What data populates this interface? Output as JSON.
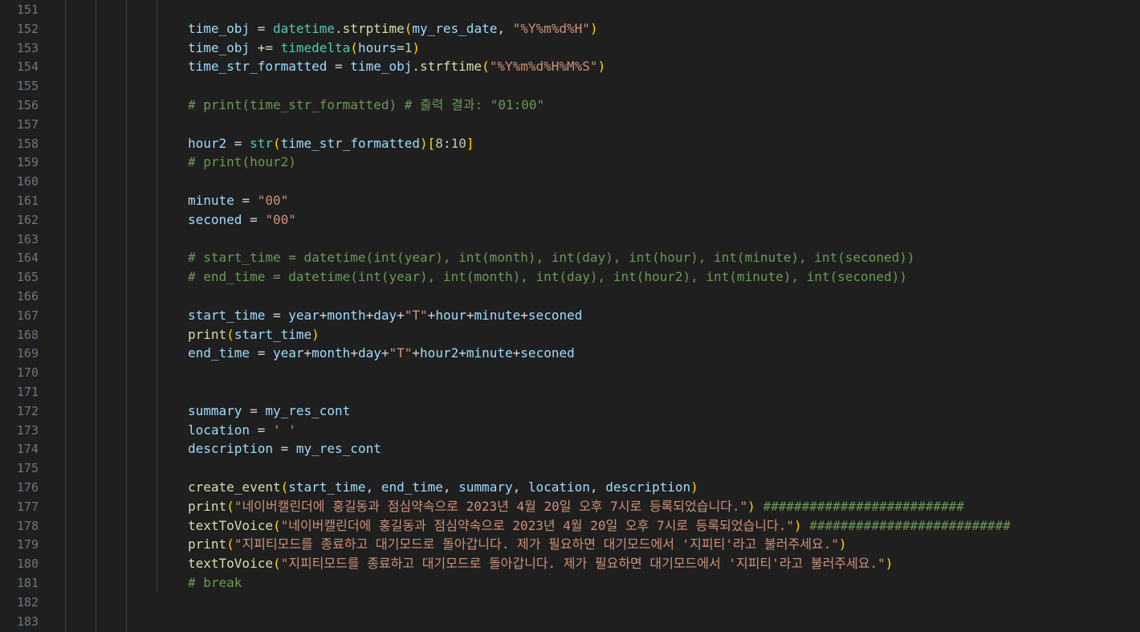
{
  "editor": {
    "lines": [
      {
        "n": "151",
        "tokens": []
      },
      {
        "n": "152",
        "tokens": [
          [
            "time_obj",
            "t-def"
          ],
          [
            " = ",
            "t-op"
          ],
          [
            "datetime",
            "t-cls"
          ],
          [
            ".",
            "t-op"
          ],
          [
            "strptime",
            "t-fn"
          ],
          [
            "(",
            "t-br1"
          ],
          [
            "my_res_date",
            "t-def"
          ],
          [
            ", ",
            "t-op"
          ],
          [
            "\"%Y%m%d%H\"",
            "t-str"
          ],
          [
            ")",
            "t-br1"
          ]
        ]
      },
      {
        "n": "153",
        "tokens": [
          [
            "time_obj",
            "t-def"
          ],
          [
            " += ",
            "t-op"
          ],
          [
            "timedelta",
            "t-cls"
          ],
          [
            "(",
            "t-br1"
          ],
          [
            "hours",
            "t-def"
          ],
          [
            "=",
            "t-op"
          ],
          [
            "1",
            "t-num"
          ],
          [
            ")",
            "t-br1"
          ]
        ]
      },
      {
        "n": "154",
        "tokens": [
          [
            "time_str_formatted",
            "t-def"
          ],
          [
            " = ",
            "t-op"
          ],
          [
            "time_obj",
            "t-def"
          ],
          [
            ".",
            "t-op"
          ],
          [
            "strftime",
            "t-fn"
          ],
          [
            "(",
            "t-br1"
          ],
          [
            "\"%Y%m%d%H%M%S\"",
            "t-str"
          ],
          [
            ")",
            "t-br1"
          ]
        ]
      },
      {
        "n": "155",
        "tokens": []
      },
      {
        "n": "156",
        "tokens": [
          [
            "# print(time_str_formatted) # 출력 결과: \"01:00\"",
            "t-cmt"
          ]
        ]
      },
      {
        "n": "157",
        "tokens": []
      },
      {
        "n": "158",
        "tokens": [
          [
            "hour2",
            "t-def"
          ],
          [
            " = ",
            "t-op"
          ],
          [
            "str",
            "t-cls"
          ],
          [
            "(",
            "t-br1"
          ],
          [
            "time_str_formatted",
            "t-def"
          ],
          [
            ")",
            "t-br1"
          ],
          [
            "[",
            "t-br1"
          ],
          [
            "8",
            "t-num"
          ],
          [
            ":",
            "t-op"
          ],
          [
            "10",
            "t-num"
          ],
          [
            "]",
            "t-br1"
          ]
        ]
      },
      {
        "n": "159",
        "tokens": [
          [
            "# print(hour2)",
            "t-cmt"
          ]
        ]
      },
      {
        "n": "160",
        "tokens": []
      },
      {
        "n": "161",
        "tokens": [
          [
            "minute",
            "t-def"
          ],
          [
            " = ",
            "t-op"
          ],
          [
            "\"00\"",
            "t-str"
          ]
        ]
      },
      {
        "n": "162",
        "tokens": [
          [
            "seconed",
            "t-def"
          ],
          [
            " = ",
            "t-op"
          ],
          [
            "\"00\"",
            "t-str"
          ]
        ]
      },
      {
        "n": "163",
        "tokens": []
      },
      {
        "n": "164",
        "tokens": [
          [
            "# start_time = datetime(int(year), int(month), int(day), int(hour), int(minute), int(seconed))",
            "t-cmt"
          ]
        ]
      },
      {
        "n": "165",
        "tokens": [
          [
            "# end_time = datetime(int(year), int(month), int(day), int(hour2), int(minute), int(seconed))",
            "t-cmt"
          ]
        ]
      },
      {
        "n": "166",
        "tokens": []
      },
      {
        "n": "167",
        "tokens": [
          [
            "start_time",
            "t-def"
          ],
          [
            " = ",
            "t-op"
          ],
          [
            "year",
            "t-def"
          ],
          [
            "+",
            "t-op"
          ],
          [
            "month",
            "t-def"
          ],
          [
            "+",
            "t-op"
          ],
          [
            "day",
            "t-def"
          ],
          [
            "+",
            "t-op"
          ],
          [
            "\"T\"",
            "t-str"
          ],
          [
            "+",
            "t-op"
          ],
          [
            "hour",
            "t-def"
          ],
          [
            "+",
            "t-op"
          ],
          [
            "minute",
            "t-def"
          ],
          [
            "+",
            "t-op"
          ],
          [
            "seconed",
            "t-def"
          ]
        ]
      },
      {
        "n": "168",
        "tokens": [
          [
            "print",
            "t-fn"
          ],
          [
            "(",
            "t-br1"
          ],
          [
            "start_time",
            "t-def"
          ],
          [
            ")",
            "t-br1"
          ]
        ]
      },
      {
        "n": "169",
        "tokens": [
          [
            "end_time",
            "t-def"
          ],
          [
            " = ",
            "t-op"
          ],
          [
            "year",
            "t-def"
          ],
          [
            "+",
            "t-op"
          ],
          [
            "month",
            "t-def"
          ],
          [
            "+",
            "t-op"
          ],
          [
            "day",
            "t-def"
          ],
          [
            "+",
            "t-op"
          ],
          [
            "\"T\"",
            "t-str"
          ],
          [
            "+",
            "t-op"
          ],
          [
            "hour2",
            "t-def"
          ],
          [
            "+",
            "t-op"
          ],
          [
            "minute",
            "t-def"
          ],
          [
            "+",
            "t-op"
          ],
          [
            "seconed",
            "t-def"
          ]
        ]
      },
      {
        "n": "170",
        "tokens": []
      },
      {
        "n": "171",
        "tokens": []
      },
      {
        "n": "172",
        "tokens": [
          [
            "summary",
            "t-def"
          ],
          [
            " = ",
            "t-op"
          ],
          [
            "my_res_cont",
            "t-def"
          ]
        ]
      },
      {
        "n": "173",
        "tokens": [
          [
            "location",
            "t-def"
          ],
          [
            " = ",
            "t-op"
          ],
          [
            "' '",
            "t-str"
          ]
        ]
      },
      {
        "n": "174",
        "tokens": [
          [
            "description",
            "t-def"
          ],
          [
            " = ",
            "t-op"
          ],
          [
            "my_res_cont",
            "t-def"
          ]
        ]
      },
      {
        "n": "175",
        "tokens": []
      },
      {
        "n": "176",
        "tokens": [
          [
            "create_event",
            "t-fn"
          ],
          [
            "(",
            "t-br1"
          ],
          [
            "start_time",
            "t-def"
          ],
          [
            ", ",
            "t-op"
          ],
          [
            "end_time",
            "t-def"
          ],
          [
            ", ",
            "t-op"
          ],
          [
            "summary",
            "t-def"
          ],
          [
            ", ",
            "t-op"
          ],
          [
            "location",
            "t-def"
          ],
          [
            ", ",
            "t-op"
          ],
          [
            "description",
            "t-def"
          ],
          [
            ")",
            "t-br1"
          ]
        ]
      },
      {
        "n": "177",
        "tokens": [
          [
            "print",
            "t-fn"
          ],
          [
            "(",
            "t-br1"
          ],
          [
            "\"네이버캘린더에 홍길동과 점심약속으로 2023년 4월 20일 오후 7시로 등록되었습니다.\"",
            "t-str"
          ],
          [
            ")",
            "t-br1"
          ],
          [
            " ",
            "t-op"
          ],
          [
            "##########################",
            "t-cmt"
          ]
        ]
      },
      {
        "n": "178",
        "tokens": [
          [
            "textToVoice",
            "t-fn"
          ],
          [
            "(",
            "t-br1"
          ],
          [
            "\"네이버캘린더에 홍길동과 점심약속으로 2023년 4월 20일 오후 7시로 등록되었습니다.\"",
            "t-str"
          ],
          [
            ")",
            "t-br1"
          ],
          [
            " ",
            "t-op"
          ],
          [
            "##########################",
            "t-cmt"
          ]
        ]
      },
      {
        "n": "179",
        "tokens": [
          [
            "print",
            "t-fn"
          ],
          [
            "(",
            "t-br1"
          ],
          [
            "\"지피티모드를 종료하고 대기모드로 돌아갑니다. 제가 필요하면 대기모드에서 '지피티'라고 불러주세요.\"",
            "t-str"
          ],
          [
            ")",
            "t-br1"
          ]
        ]
      },
      {
        "n": "180",
        "tokens": [
          [
            "textToVoice",
            "t-fn"
          ],
          [
            "(",
            "t-br1"
          ],
          [
            "\"지피티모드를 종료하고 대기모드로 돌아갑니다. 제가 필요하면 대기모드에서 '지피티'라고 불러주세요.\"",
            "t-str"
          ],
          [
            ")",
            "t-br1"
          ]
        ]
      },
      {
        "n": "181",
        "tokens": [
          [
            "# break",
            "t-cmt"
          ]
        ]
      },
      {
        "n": "182",
        "tokens": []
      },
      {
        "n": "183",
        "tokens": []
      }
    ]
  }
}
